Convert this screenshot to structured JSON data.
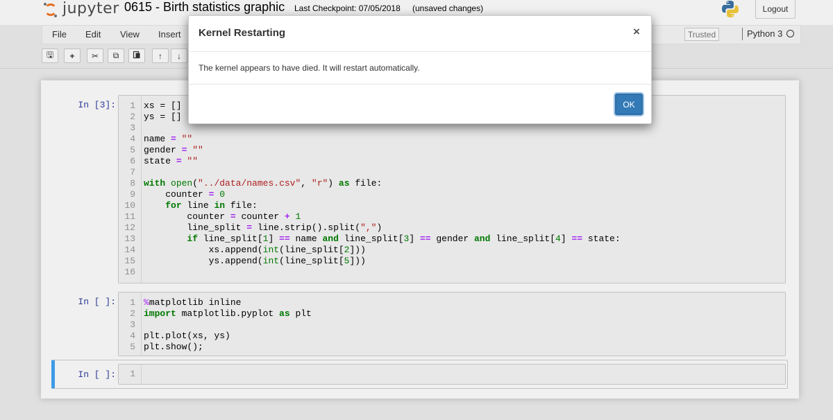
{
  "header": {
    "logo_text": "jupyter",
    "notebook_title": "0615 - Birth statistics graphic",
    "checkpoint": "Last Checkpoint: 07/05/2018",
    "unsaved": "(unsaved changes)",
    "logout_label": "Logout"
  },
  "menubar": {
    "items": [
      "File",
      "Edit",
      "View",
      "Insert"
    ],
    "trusted_label": "Trusted",
    "kernel_name": "Python 3"
  },
  "toolbar": {
    "icons": [
      "save-icon",
      "plus-icon",
      "cut-icon",
      "copy-icon",
      "paste-icon",
      "arrow-up-icon",
      "arrow-down-icon"
    ],
    "glyphs": [
      "🖫",
      "+",
      "✂",
      "⧉",
      "📋",
      "↑",
      "↓"
    ]
  },
  "cells": [
    {
      "prompt": "In [3]:",
      "line_numbers": [
        "1",
        "2",
        "3",
        "4",
        "5",
        "6",
        "7",
        "8",
        "9",
        "10",
        "11",
        "12",
        "13",
        "14",
        "15",
        "16"
      ]
    },
    {
      "prompt": "In [ ]:",
      "line_numbers": [
        "1",
        "2",
        "3",
        "4",
        "5"
      ]
    },
    {
      "prompt": "In [ ]:",
      "line_numbers": [
        "1"
      ]
    }
  ],
  "code": {
    "c1": {
      "l1": "xs = []",
      "l2": "ys = []",
      "l4a": "name ",
      "l4b": "= ",
      "l4c": "\"\"",
      "l5a": "gender ",
      "l5b": "= ",
      "l5c": "\"\"",
      "l6a": "state ",
      "l6b": "= ",
      "l6c": "\"\"",
      "l8a": "with ",
      "l8b": "open",
      "l8c": "(",
      "l8d": "\"../data/names.csv\"",
      "l8e": ", ",
      "l8f": "\"r\"",
      "l8g": ") ",
      "l8h": "as",
      "l8i": " file:",
      "l9a": "    counter ",
      "l9b": "=",
      "l9c": " 0",
      "l10a": "    ",
      "l10b": "for",
      "l10c": " line ",
      "l10d": "in",
      "l10e": " file:",
      "l11a": "        counter ",
      "l11b": "=",
      "l11c": " counter ",
      "l11d": "+",
      "l11e": " 1",
      "l12a": "        line_split ",
      "l12b": "=",
      "l12c": " line.strip().split(",
      "l12d": "\",\"",
      "l12e": ")",
      "l13a": "        ",
      "l13b": "if",
      "l13c": " line_split[",
      "l13d": "1",
      "l13e": "] ",
      "l13f": "==",
      "l13g": " name ",
      "l13h": "and",
      "l13i": " line_split[",
      "l13j": "3",
      "l13k": "] ",
      "l13l": "==",
      "l13m": " gender ",
      "l13n": "and",
      "l13o": " line_split[",
      "l13p": "4",
      "l13q": "] ",
      "l13r": "==",
      "l13s": " state:",
      "l14a": "            xs.append(",
      "l14b": "int",
      "l14c": "(line_split[",
      "l14d": "2",
      "l14e": "]))",
      "l15a": "            ys.append(",
      "l15b": "int",
      "l15c": "(line_split[",
      "l15d": "5",
      "l15e": "]))"
    },
    "c2": {
      "l1a": "%",
      "l1b": "matplotlib inline",
      "l2a": "import",
      "l2b": " matplotlib.pyplot ",
      "l2c": "as",
      "l2d": " plt",
      "l4": "plt.plot(xs, ys)",
      "l5": "plt.show();"
    }
  },
  "modal": {
    "title": "Kernel Restarting",
    "close_glyph": "×",
    "body": "The kernel appears to have died. It will restart automatically.",
    "ok_label": "OK"
  },
  "colors": {
    "accent": "#337ab7",
    "selected_cell": "#42a5f5",
    "prompt": "#303f9f",
    "logo": "#f37626"
  }
}
